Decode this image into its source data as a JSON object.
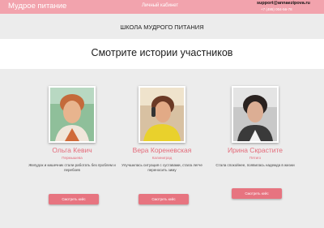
{
  "header": {
    "brand": "Мудрое питание",
    "cabinet_link": "Личный кабинет",
    "email": "support@annaezipova.ru",
    "phone": "+7 (495) 004-56-78"
  },
  "school_title": "ШКОЛА МУДРОГО ПИТАНИЯ",
  "section_title": "Смотрите истории участников",
  "stories": [
    {
      "name": "Ольга Кевич",
      "city": "Пермышева",
      "quote": "Желудок и кишечник стали работать без проблем и перебоев",
      "button": "Смотреть кейс"
    },
    {
      "name": "Вера Кореневская",
      "city": "Калиниград",
      "quote": "Улучшилась ситуация с суставами, стала легче переносить зиму",
      "button": "Смотреть кейс"
    },
    {
      "name": "Ирина Скрастите",
      "city": "Пятиго",
      "quote": "Стала спокойнее, появилась надежда в жизни",
      "button": "Смотреть кейс"
    }
  ],
  "colors": {
    "topbar": "#f2a3ad",
    "accent": "#e36b7a",
    "button": "#e77480",
    "background": "#ececec"
  }
}
